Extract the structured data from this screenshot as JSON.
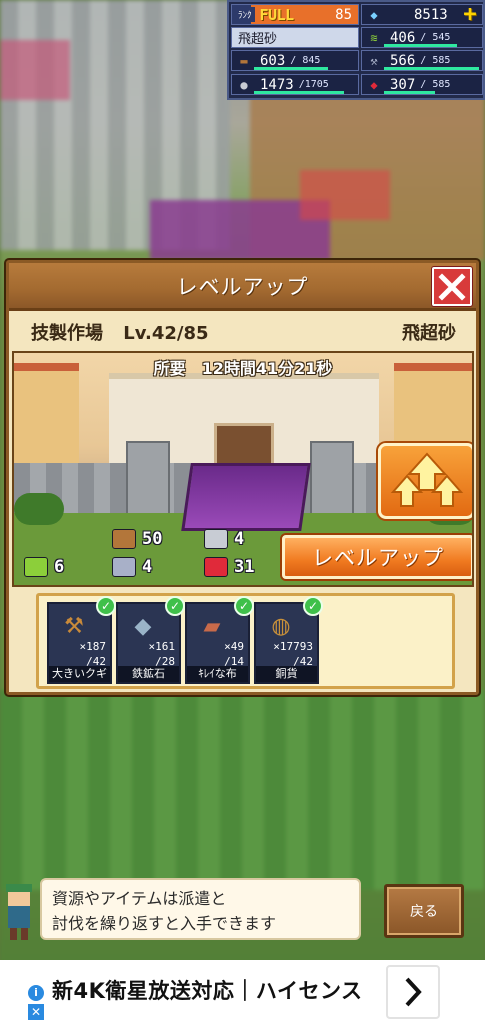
{
  "hud": {
    "rank_label": "ﾗﾝｸ",
    "rank_status": "FULL",
    "rank_value": "85",
    "gems": "8513",
    "selected_material": "飛超砂",
    "resources": [
      {
        "icon": "grass-icon",
        "value": "406",
        "max": "/ 545",
        "fill": 0.745,
        "color": "#8ccf3a"
      },
      {
        "icon": "wood-icon",
        "value": "603",
        "max": "/ 845",
        "fill": 0.714,
        "color": "#b3763a"
      },
      {
        "icon": "tools-icon",
        "value": "566",
        "max": "/ 585",
        "fill": 0.968,
        "color": "#a8b0c8"
      },
      {
        "icon": "silver-coin-icon",
        "value": "1473",
        "max": "/1705",
        "fill": 0.864,
        "color": "#c8ccd4"
      },
      {
        "icon": "ruby-icon",
        "value": "307",
        "max": "/ 585",
        "fill": 0.525,
        "color": "#e02a3a"
      }
    ]
  },
  "dialog": {
    "title": "レベルアップ",
    "facility": "技製作場",
    "level": "Lv.42/85",
    "material": "飛超砂",
    "time_required": "所要　12時間41分21秒",
    "levelup_button": "レベルアップ",
    "costs": [
      {
        "icon": "grass-icon",
        "value": "6",
        "color": "#8ccf3a"
      },
      {
        "icon": "wood-icon",
        "value": "50",
        "color": "#b3763a"
      },
      {
        "icon": "tools-icon",
        "value": "4",
        "color": "#a8b0c8"
      },
      {
        "icon": "silver-coin-icon",
        "value": "4",
        "color": "#c8ccd4"
      },
      {
        "icon": "ruby-icon",
        "value": "31",
        "color": "#e02a3a"
      }
    ],
    "items": [
      {
        "name": "大きいクギ",
        "have": "×187",
        "need": "/42",
        "icon": "nail-icon",
        "glyph": "⚒"
      },
      {
        "name": "鉄鉱石",
        "have": "×161",
        "need": "/28",
        "icon": "iron-ore-icon",
        "glyph": "◆"
      },
      {
        "name": "ｷﾚｲな布",
        "have": "×49",
        "need": "/14",
        "icon": "cloth-icon",
        "glyph": "▰"
      },
      {
        "name": "銅貨",
        "have": "×17793",
        "need": "/42",
        "icon": "copper-coin-icon",
        "glyph": "◍"
      }
    ]
  },
  "hint": {
    "text_line1": "資源やアイテムは派遣と",
    "text_line2": "討伐を繰り返すと入手できます"
  },
  "back_button": "戻る",
  "ad": {
    "text": "新4K衛星放送対応｜ハイセンス"
  }
}
